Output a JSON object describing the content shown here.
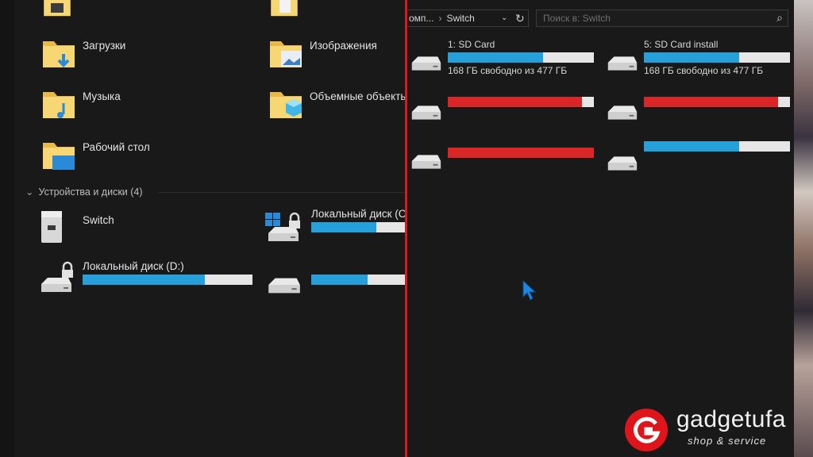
{
  "left": {
    "folders": [
      {
        "label": "Загрузки",
        "icon": "downloads-folder-icon"
      },
      {
        "label": "Изображения",
        "icon": "pictures-folder-icon"
      },
      {
        "label": "Музыка",
        "icon": "music-folder-icon"
      },
      {
        "label": "Объемные объекты",
        "icon": "3d-objects-folder-icon"
      },
      {
        "label": "Рабочий стол",
        "icon": "desktop-folder-icon"
      }
    ],
    "section_title": "Устройства и диски (4)",
    "devices": [
      {
        "label": "Switch",
        "icon": "device-icon"
      },
      {
        "label": "Локальный диск (C",
        "icon": "windows-drive-icon",
        "usage_fraction": 0.67
      },
      {
        "label": "Локальный диск (D:)",
        "icon": "locked-drive-icon",
        "usage_fraction": 0.72
      },
      {
        "label": "",
        "icon": "drive-icon",
        "usage_fraction": 0.58
      }
    ]
  },
  "right": {
    "breadcrumb": {
      "parent": "омп...",
      "current": "Switch"
    },
    "search": {
      "placeholder": "Поиск в: Switch"
    },
    "drives": [
      {
        "name": "1: SD Card",
        "free_text": "168 ГБ свободно из 477 ГБ",
        "usage_fraction": 0.65,
        "status": "blue"
      },
      {
        "name": "5: SD Card install",
        "free_text": "168 ГБ свободно из 477 ГБ",
        "usage_fraction": 0.65,
        "status": "blue"
      },
      {
        "name": "",
        "free_text": "",
        "usage_fraction": 0.92,
        "status": "red"
      },
      {
        "name": "",
        "free_text": "",
        "usage_fraction": 0.92,
        "status": "red"
      },
      {
        "name": "",
        "free_text": "",
        "usage_fraction": 1.0,
        "status": "red"
      },
      {
        "name": "",
        "free_text": "",
        "usage_fraction": 0.65,
        "status": "blue"
      }
    ]
  },
  "watermark": {
    "brand": "gadgetufa",
    "tagline": "shop & service"
  },
  "colors": {
    "accent_divider": "#e0151b",
    "bar_blue": "#26a0da",
    "bar_red": "#da2626",
    "bar_track": "#e6e6e6"
  }
}
